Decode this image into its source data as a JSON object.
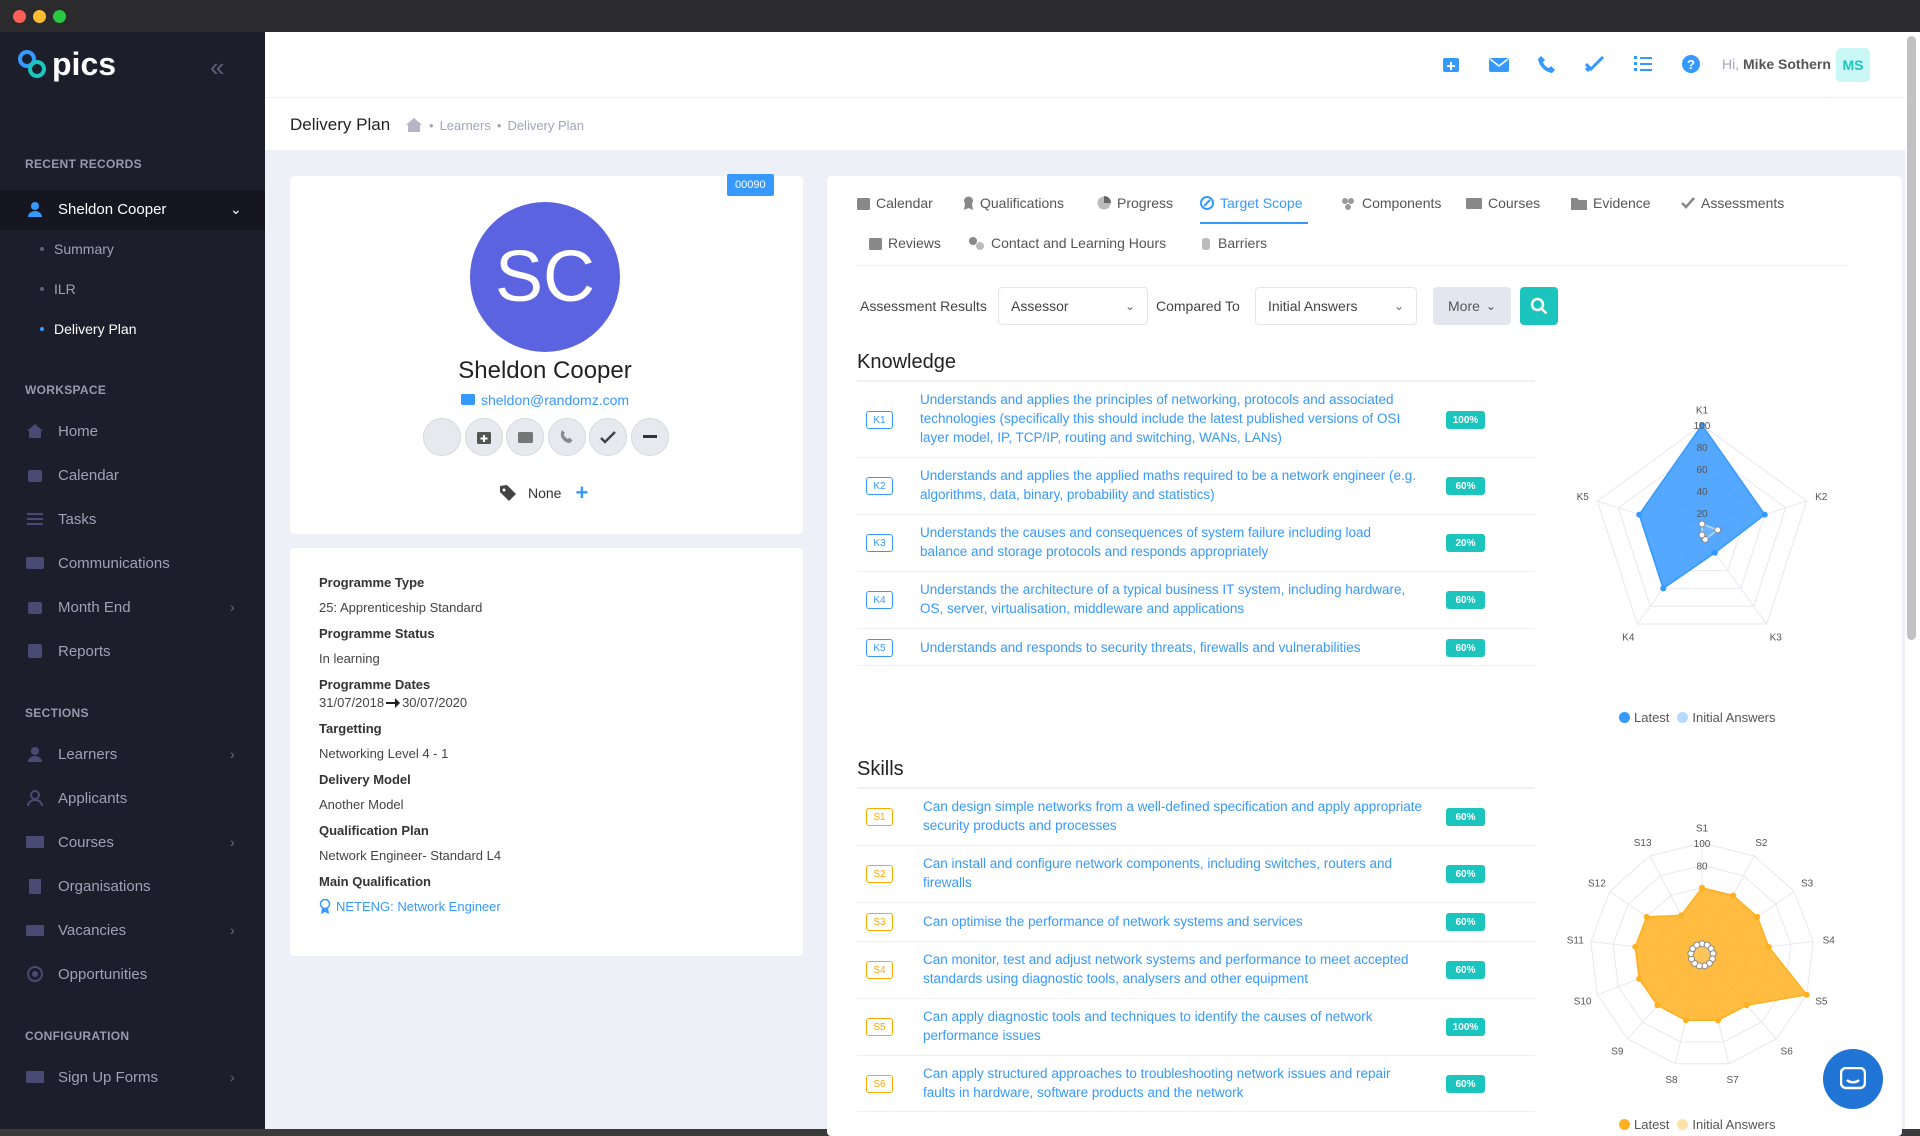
{
  "app": {
    "name": "pics"
  },
  "sidebar": {
    "recent_title": "RECENT RECORDS",
    "recent_record": "Sheldon Cooper",
    "recent_sub": [
      "Summary",
      "ILR",
      "Delivery Plan"
    ],
    "workspace_title": "WORKSPACE",
    "workspace": [
      "Home",
      "Calendar",
      "Tasks",
      "Communications",
      "Month End",
      "Reports"
    ],
    "sections_title": "SECTIONS",
    "sections": [
      "Learners",
      "Applicants",
      "Courses",
      "Organisations",
      "Vacancies",
      "Opportunities"
    ],
    "config_title": "CONFIGURATION",
    "config": [
      "Sign Up Forms"
    ]
  },
  "topbar": {
    "greeting": "Hi,",
    "user_name": "Mike Sothern",
    "initials": "MS"
  },
  "subheader": {
    "title": "Delivery Plan",
    "crumbs": [
      "Learners",
      "Delivery Plan"
    ]
  },
  "profile": {
    "id_badge": "00090",
    "initials": "SC",
    "name": "Sheldon Cooper",
    "email": "sheldon@randomz.com",
    "tags": "None"
  },
  "details": [
    {
      "label": "Programme Type",
      "value": "25: Apprenticeship Standard"
    },
    {
      "label": "Programme Status",
      "value": "In learning"
    },
    {
      "label": "Programme Dates",
      "value_from": "31/07/2018",
      "value_to": "30/07/2020"
    },
    {
      "label": "Targetting",
      "value": "Networking Level 4 - 1"
    },
    {
      "label": "Delivery Model",
      "value": "Another Model"
    },
    {
      "label": "Qualification Plan",
      "value": "Network Engineer- Standard L4"
    },
    {
      "label": "Main Qualification",
      "value": "NETENG: Network Engineer"
    }
  ],
  "tabs": [
    "Calendar",
    "Qualifications",
    "Progress",
    "Target Scope",
    "Components",
    "Courses",
    "Evidence",
    "Assessments",
    "Reviews",
    "Contact and Learning Hours",
    "Barriers"
  ],
  "active_tab": "Target Scope",
  "filters": {
    "results_label": "Assessment Results",
    "results_value": "Assessor",
    "compared_label": "Compared To",
    "compared_value": "Initial Answers",
    "more_label": "More"
  },
  "knowledge": {
    "title": "Knowledge",
    "items": [
      {
        "code": "K1",
        "text": "Understands and applies the principles of networking, protocols and associated technologies (specifically this should include the latest published versions of OSI layer model, IP, TCP/IP, routing and switching, WANs, LANs)",
        "pct": "100%"
      },
      {
        "code": "K2",
        "text": "Understands and applies the applied maths required to be a network engineer (e.g. algorithms, data, binary, probability and statistics)",
        "pct": "60%"
      },
      {
        "code": "K3",
        "text": "Understands the causes and consequences of system failure including load balance and storage protocols and responds appropriately",
        "pct": "20%"
      },
      {
        "code": "K4",
        "text": "Understands the architecture of a typical business IT system, including hardware, OS, server, virtualisation, middleware and applications",
        "pct": "60%"
      },
      {
        "code": "K5",
        "text": "Understands and responds to security threats, firewalls and vulnerabilities",
        "pct": "60%"
      }
    ]
  },
  "skills": {
    "title": "Skills",
    "items": [
      {
        "code": "S1",
        "text": "Can design simple networks from a well-defined specification and apply appropriate security products and processes",
        "pct": "60%"
      },
      {
        "code": "S2",
        "text": "Can install and configure network components, including switches, routers and firewalls",
        "pct": "60%"
      },
      {
        "code": "S3",
        "text": "Can optimise the performance of network systems and services",
        "pct": "60%"
      },
      {
        "code": "S4",
        "text": "Can monitor, test and adjust network systems and performance to meet accepted standards using diagnostic tools, analysers and other equipment",
        "pct": "60%"
      },
      {
        "code": "S5",
        "text": "Can apply diagnostic tools and techniques to identify the causes of network performance issues",
        "pct": "100%"
      },
      {
        "code": "S6",
        "text": "Can apply structured approaches to troubleshooting network issues and repair faults in hardware, software products and the network",
        "pct": "60%"
      }
    ]
  },
  "chart_data": [
    {
      "type": "radar",
      "axes": [
        "K1",
        "K2",
        "K3",
        "K4",
        "K5"
      ],
      "range": [
        0,
        100
      ],
      "ticks": [
        "100",
        "80",
        "60",
        "40",
        "20"
      ],
      "series": [
        {
          "name": "Latest",
          "values": [
            100,
            60,
            20,
            60,
            60
          ],
          "color": "#3699ff"
        },
        {
          "name": "Initial Answers",
          "values": [
            10,
            15,
            5,
            0,
            0
          ],
          "color": "#b8d9ff"
        }
      ],
      "legend": "bottom"
    },
    {
      "type": "radar",
      "axes": [
        "S1",
        "S2",
        "S3",
        "S4",
        "S5",
        "S6",
        "S7",
        "S8",
        "S9",
        "S10",
        "S11",
        "S12",
        "S13"
      ],
      "range": [
        0,
        100
      ],
      "ticks": [
        "100",
        "80"
      ],
      "series": [
        {
          "name": "Latest",
          "values": [
            60,
            60,
            60,
            60,
            100,
            60,
            60,
            60,
            60,
            60,
            60,
            60,
            40
          ],
          "color": "#ffb020"
        },
        {
          "name": "Initial Answers",
          "values": [
            10,
            10,
            10,
            10,
            10,
            10,
            10,
            10,
            10,
            10,
            10,
            10,
            10
          ],
          "color": "#ffe3a6"
        }
      ],
      "legend": "bottom"
    }
  ]
}
